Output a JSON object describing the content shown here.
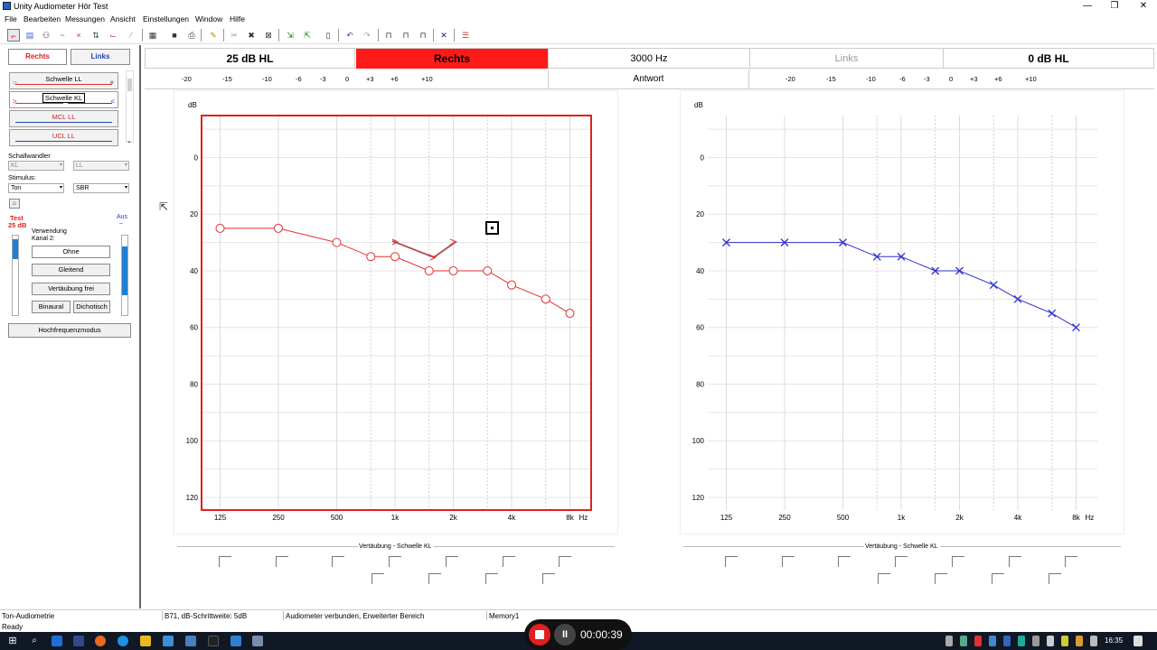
{
  "window": {
    "title": "Unity Audiometer Hör  Test",
    "minimize": "—",
    "maximize": "❐",
    "close": "✕"
  },
  "menu": [
    "File",
    "Bearbeiten",
    "Messungen",
    "Ansicht",
    "Einstellungen",
    "Window",
    "Hilfe"
  ],
  "left_panel": {
    "tab_right": "Rechts",
    "tab_left": "Links",
    "curves": [
      "Schwelle LL",
      "Schwelle KL",
      "MCL LL",
      "UCL LL"
    ],
    "transducer_label": "Schallwandler",
    "transducer_value": "KL",
    "transducer_value2": "LL",
    "stimulus_label": "Stimulus:",
    "stimulus_value": "Ton",
    "stimulus_value2": "SBR",
    "test_label": "Test",
    "test_level": "25 dB",
    "off_label": "Aus",
    "off_dash": "–",
    "usage_label": "Verwendung",
    "channel_label": "Kanal 2:",
    "buttons": [
      "Ohne",
      "Gleitend",
      "Vertäubung frei",
      "Binaural",
      "Dichotisch"
    ],
    "highfreq_button": "Hochfrequenzmodus",
    "test_level_fraction": 0.25,
    "off_level_fraction": 0.85
  },
  "header": {
    "level_right": "25 dB HL",
    "side_right": "Rechts",
    "frequency": "3000 Hz",
    "side_left": "Links",
    "level_left": "0 dB HL",
    "response": "Antwort",
    "ticks": [
      "-20",
      "-15",
      "-10",
      "-6",
      "-3",
      "0",
      "+3",
      "+6",
      "+10"
    ],
    "colors": {
      "active_side": "#ff1a1a"
    }
  },
  "audiogram": {
    "y_unit": "dB",
    "x_unit": "Hz",
    "y_ticks": [
      "0",
      "20",
      "40",
      "60",
      "80",
      "100",
      "120"
    ],
    "x_ticks": [
      "125",
      "250",
      "500",
      "1k",
      "2k",
      "4k",
      "8k"
    ],
    "masking_title": "Vertäubung - Schwelle KL"
  },
  "chart_data": [
    {
      "type": "line",
      "ear": "right",
      "title": "",
      "ylabel": "dB",
      "xlabel": "Hz",
      "ylim": [
        -10,
        125
      ],
      "y_reversed": true,
      "x_scale": "log",
      "series": [
        {
          "symbol": "circle",
          "color": "#e23030",
          "x": [
            125,
            250,
            500,
            750,
            1000,
            1500,
            2000,
            3000,
            4000,
            6000,
            8000
          ],
          "values": [
            25,
            25,
            30,
            35,
            35,
            40,
            40,
            40,
            45,
            50,
            55
          ]
        }
      ]
    },
    {
      "type": "line",
      "ear": "left",
      "title": "",
      "ylabel": "dB",
      "xlabel": "Hz",
      "ylim": [
        -10,
        125
      ],
      "y_reversed": true,
      "x_scale": "log",
      "series": [
        {
          "symbol": "cross",
          "color": "#3030d0",
          "x": [
            125,
            250,
            500,
            750,
            1000,
            1500,
            2000,
            3000,
            4000,
            6000,
            8000
          ],
          "values": [
            30,
            30,
            30,
            35,
            35,
            40,
            40,
            45,
            50,
            55,
            60
          ]
        }
      ]
    }
  ],
  "status": {
    "mode": "Ton-Audiometrie",
    "ready": "Ready",
    "step": "B71, dB-Schrittweite: 5dB",
    "connection": "Audiometer verbunden, Erweiterter Bereich",
    "memory": "Memory1"
  },
  "recorder": {
    "pause": "II",
    "time": "00:00:39"
  },
  "taskbar": {
    "clock": "16:35"
  }
}
